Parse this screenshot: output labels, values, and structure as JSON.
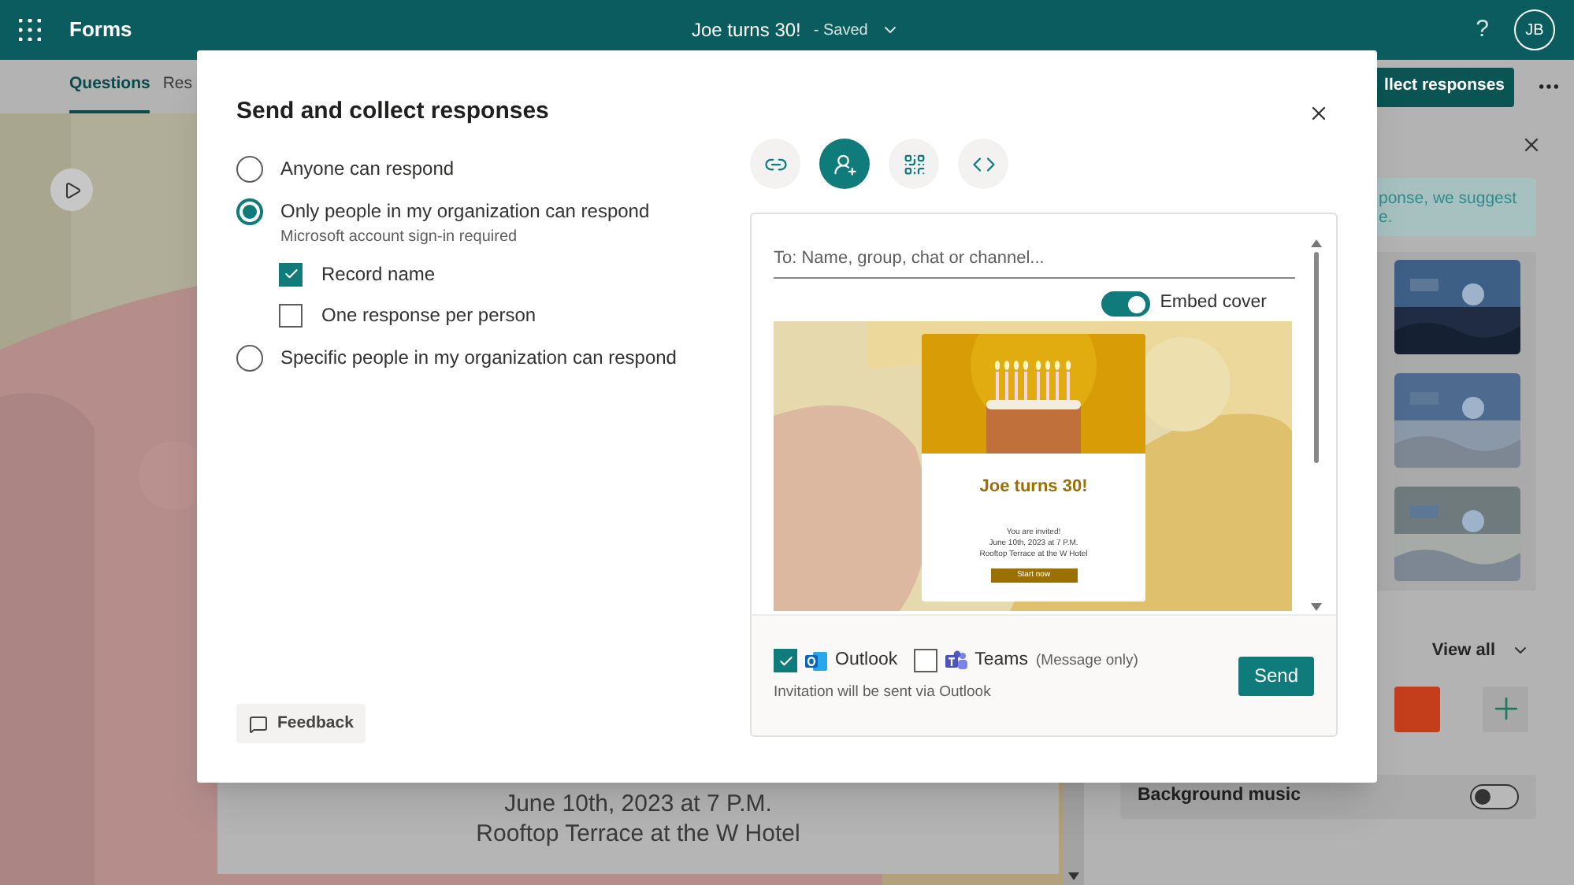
{
  "app_bar": {
    "app_name": "Forms",
    "form_title": "Joe turns 30!",
    "save_status": "- Saved",
    "help": "?",
    "avatar": "JB"
  },
  "tabs": [
    {
      "label": "Questions",
      "selected": true
    },
    {
      "label": "Res",
      "selected": false
    }
  ],
  "collect_button": "llect responses",
  "canvas": {
    "lines": [
      "June 10th, 2023 at 7 P.M.",
      "Rooftop Terrace at the W Hotel"
    ]
  },
  "side_panel": {
    "tip_lines": [
      "ponse, we suggest",
      "e."
    ],
    "view_all": "View all",
    "swatches": [
      {
        "color": "#c43e1c"
      }
    ],
    "background_music": {
      "label": "Background music",
      "on": false
    }
  },
  "dialog": {
    "title": "Send and collect responses",
    "options": [
      {
        "label": "Anyone can respond",
        "selected": false
      },
      {
        "label": "Only people in my organization can respond",
        "note": "Microsoft account sign-in required",
        "selected": true,
        "children": [
          {
            "label": "Record name",
            "checked": true
          },
          {
            "label": "One response per person",
            "checked": false
          }
        ]
      },
      {
        "label": "Specific people in my organization can respond",
        "selected": false
      }
    ],
    "feedback": "Feedback",
    "share_modes": [
      {
        "kind": "link",
        "selected": false
      },
      {
        "kind": "invite",
        "selected": true
      },
      {
        "kind": "qr",
        "selected": false
      },
      {
        "kind": "embed",
        "selected": false
      }
    ],
    "recipient": {
      "placeholder": "To: Name, group, chat or channel..."
    },
    "embed_cover": {
      "label": "Embed cover",
      "on": true
    },
    "invitation": {
      "title": "Joe turns 30!",
      "lines": [
        "You are invited!",
        "June 10th, 2023 at 7 P.M.",
        "Rooftop Terrace at the W Hotel"
      ],
      "button": "Start now"
    },
    "channels": [
      {
        "kind": "outlook",
        "label": "Outlook",
        "checked": true
      },
      {
        "kind": "teams",
        "label": "Teams",
        "note": "(Message only)",
        "checked": false
      }
    ],
    "hint": "Invitation will be sent via Outlook",
    "send": "Send"
  }
}
